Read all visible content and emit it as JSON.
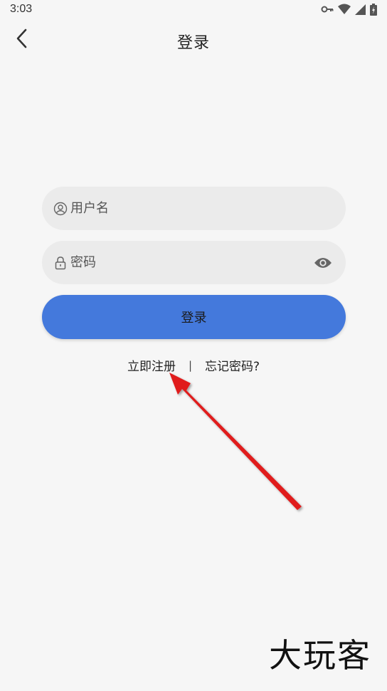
{
  "status_bar": {
    "time": "3:03",
    "icons": [
      "vpn-key-icon",
      "wifi-icon",
      "signal-icon",
      "battery-icon"
    ]
  },
  "header": {
    "title": "登录",
    "back_icon": "chevron-left-icon"
  },
  "form": {
    "username": {
      "placeholder": "用户名",
      "value": "",
      "icon": "user-icon"
    },
    "password": {
      "placeholder": "密码",
      "value": "",
      "icon": "lock-icon",
      "toggle_icon": "eye-icon"
    },
    "login_label": "登录"
  },
  "links": {
    "register": "立即注册",
    "divider": "|",
    "forgot": "忘记密码?"
  },
  "watermark": "大玩客",
  "colors": {
    "background": "#f6f6f6",
    "field_bg": "#ebebeb",
    "primary": "#4479dc",
    "arrow": "#e01e1e"
  }
}
